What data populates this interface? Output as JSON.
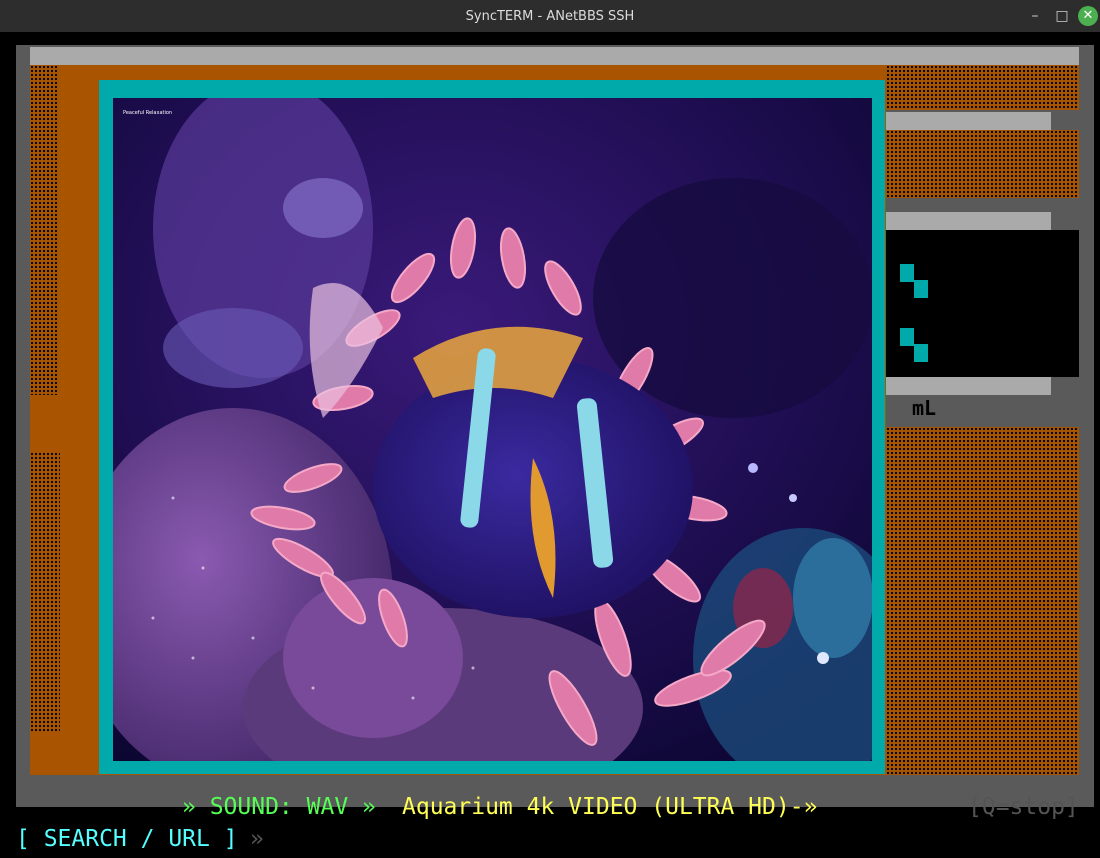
{
  "window": {
    "title": "SyncTERM - ANetBBS SSH",
    "minimize_glyph": "–",
    "maximize_glyph": "□",
    "close_glyph": "✕"
  },
  "video": {
    "overlay_text": "Peaceful Relaxation"
  },
  "side_panel": {
    "label": "mL"
  },
  "status": {
    "sound_label": "» SOUND: WAV »",
    "video_title": "Aquarium 4k VIDEO (ULTRA HD)-»",
    "stop_hint": "[Q=stop]",
    "search_label": "[ SEARCH / URL ]",
    "search_arrow": "»"
  },
  "colors": {
    "frame_orange": "#a85400",
    "frame_cyan": "#00aaaa",
    "sound_green": "#55ff55",
    "title_yellow": "#ffff55",
    "search_cyan": "#55ffff",
    "hint_gray": "#555555"
  }
}
